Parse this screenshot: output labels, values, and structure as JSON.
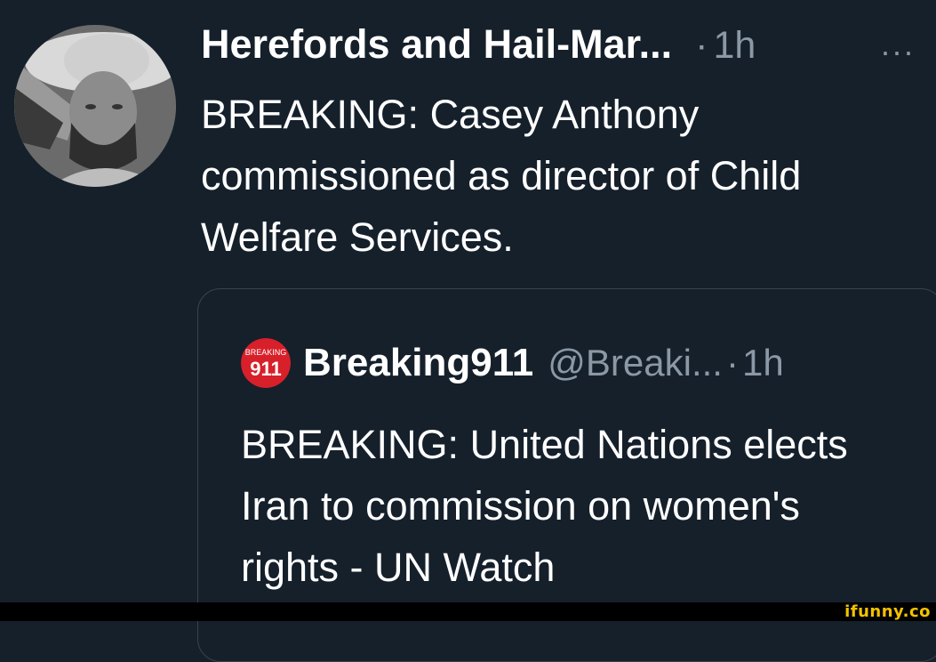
{
  "tweet": {
    "display_name": "Herefords and Hail-Mar...",
    "separator": "·",
    "time": "1h",
    "more_label": "···",
    "text": "BREAKING: Casey Anthony commissioned as director of Child Welfare Services."
  },
  "quoted_tweet": {
    "avatar_text_top": "BREAKING",
    "avatar_text_main": "911",
    "display_name": "Breaking911",
    "handle": "@Breaki...",
    "separator": "·",
    "time": "1h",
    "text": "BREAKING: United Nations elects Iran to commission on women's rights - UN Watch"
  },
  "watermark": "ifunny.co",
  "colors": {
    "background": "#15202b",
    "text_primary": "#ffffff",
    "text_secondary": "#8b98a5",
    "card_border": "#38444d",
    "watermark": "#f2c200",
    "breaking_red": "#d8202a"
  },
  "icons": {
    "more": "more-horizontal-icon"
  }
}
